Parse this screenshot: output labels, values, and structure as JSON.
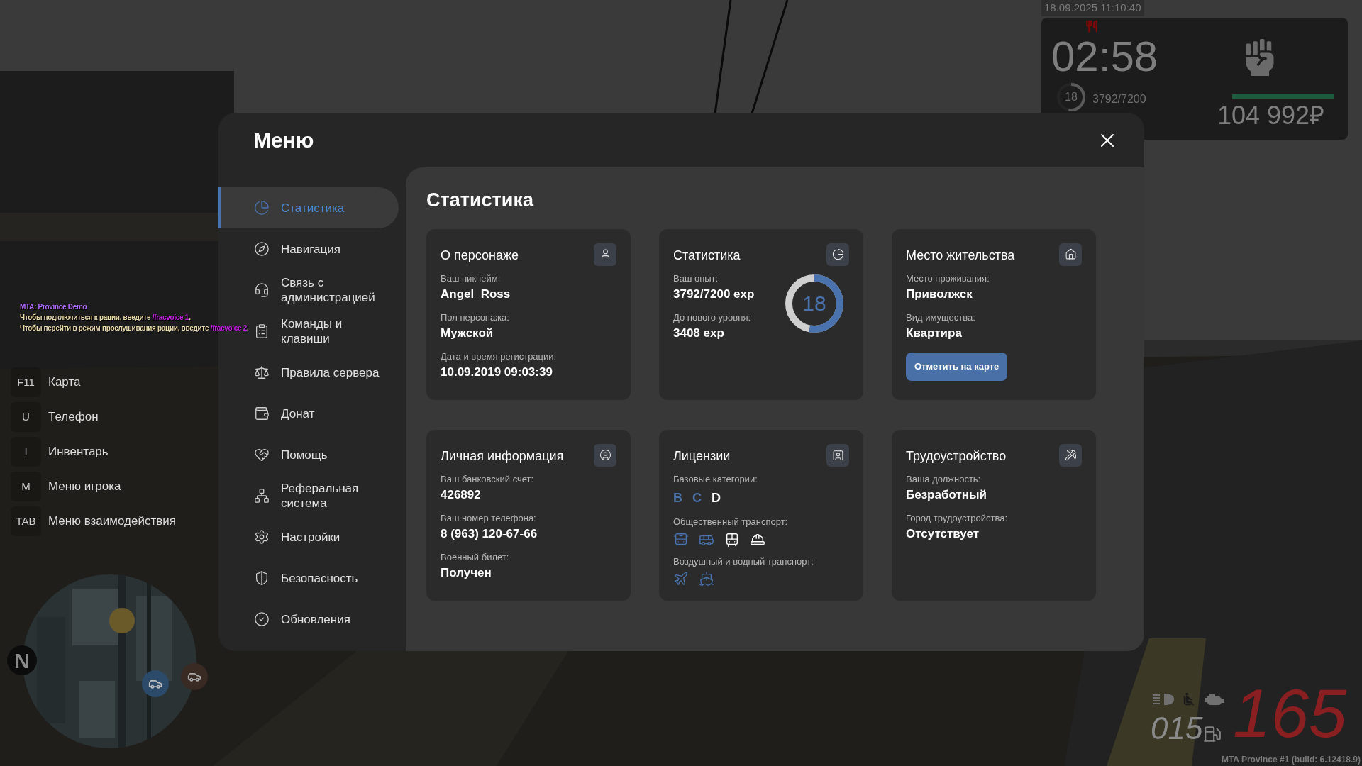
{
  "hud": {
    "datetime": "18.09.2025 11:10:40",
    "timer": "02:58",
    "level_ring": {
      "value": "18",
      "level": 0.53
    },
    "experience": "3792/7200",
    "health": {
      "level": 1.0
    },
    "money": "104 992₽"
  },
  "chat": [
    {
      "segments": [
        {
          "text": "MTA: Province Demo",
          "kind": "server"
        }
      ]
    },
    {
      "segments": [
        {
          "text": "Чтобы подключиться к рации, введите ",
          "kind": "message"
        },
        {
          "text": "/fracvoice 1",
          "kind": "command"
        },
        {
          "text": ".",
          "kind": "message"
        }
      ]
    },
    {
      "segments": [
        {
          "text": "Чтобы перейти в режим прослушивания рации, введите ",
          "kind": "message"
        },
        {
          "text": "/fracvoice 2",
          "kind": "command"
        },
        {
          "text": ".",
          "kind": "message"
        }
      ]
    }
  ],
  "keybinds": [
    {
      "key": "F11",
      "label": "Карта"
    },
    {
      "key": "U",
      "label": "Телефон"
    },
    {
      "key": "I",
      "label": "Инвентарь"
    },
    {
      "key": "M",
      "label": "Меню игрока"
    },
    {
      "key": "TAB",
      "label": "Меню взаимодействия"
    }
  ],
  "minimap": {
    "north": "N"
  },
  "menu": {
    "title": "Меню",
    "sidebar": [
      {
        "label": "Статистика",
        "selected": true
      },
      {
        "label": "Навигация",
        "selected": false
      },
      {
        "label": "Связь с администрацией",
        "selected": false
      },
      {
        "label": "Команды и клавиши",
        "selected": false
      },
      {
        "label": "Правила сервера",
        "selected": false
      },
      {
        "label": "Донат",
        "selected": false
      },
      {
        "label": "Помощь",
        "selected": false
      },
      {
        "label": "Реферальная система",
        "selected": false
      },
      {
        "label": "Настройки",
        "selected": false
      },
      {
        "label": "Безопасность",
        "selected": false
      },
      {
        "label": "Обновления",
        "selected": false
      }
    ],
    "heading": "Статистика",
    "cards": [
      {
        "kind": "info",
        "title": "О персонаже",
        "fields": [
          {
            "label": "Ваш никнейм:",
            "value": "Angel_Ross"
          },
          {
            "label": "Пол персонажа:",
            "value": "Мужской"
          },
          {
            "label": "Дата и время регистрации:",
            "value": "10.09.2019 09:03:39"
          }
        ]
      },
      {
        "kind": "stats",
        "title": "Статистика",
        "fields": [
          {
            "label": "Ваш опыт:",
            "value": "3792/7200 exp"
          },
          {
            "label": "До нового уровня:",
            "value": "3408 exp"
          }
        ],
        "ring": {
          "value": "18",
          "level": 0.53
        }
      },
      {
        "kind": "residence",
        "title": "Место жительства",
        "fields": [
          {
            "label": "Место проживания:",
            "value": "Приволжск"
          },
          {
            "label": "Вид имущества:",
            "value": "Квартира"
          }
        ],
        "button": "Отметить на карте"
      },
      {
        "kind": "info",
        "title": "Личная информация",
        "fields": [
          {
            "label": "Ваш банковский счет:",
            "value": "426892"
          },
          {
            "label": "Ваш номер телефона:",
            "value": "8 (963) 120-67-66"
          },
          {
            "label": "Военный билет:",
            "value": "Получен"
          }
        ]
      },
      {
        "kind": "licenses",
        "title": "Лицензии",
        "sections": [
          {
            "kind": "letters",
            "label": "Базовые категории:",
            "items": [
              {
                "text": "B",
                "owned": true
              },
              {
                "text": "C",
                "owned": true
              },
              {
                "text": "D",
                "owned": false
              }
            ]
          },
          {
            "kind": "ground",
            "label": "Общественный транспорт:",
            "items": [
              {
                "owned": true
              },
              {
                "owned": true
              },
              {
                "owned": false
              },
              {
                "owned": false
              }
            ]
          },
          {
            "kind": "air",
            "label": "Воздушный и водный транспорт:",
            "items": [
              {
                "owned": true
              },
              {
                "owned": true
              }
            ]
          }
        ]
      },
      {
        "kind": "info",
        "title": "Трудоустройство",
        "fields": [
          {
            "label": "Ваша должность:",
            "value": "Безработный"
          },
          {
            "label": "Город трудоустройства:",
            "value": "Отсутствует"
          }
        ]
      }
    ]
  },
  "vehicle": {
    "speed": "165",
    "fuel": "015"
  },
  "version": "MTA Province #1 (build: 6.12418.9)"
}
